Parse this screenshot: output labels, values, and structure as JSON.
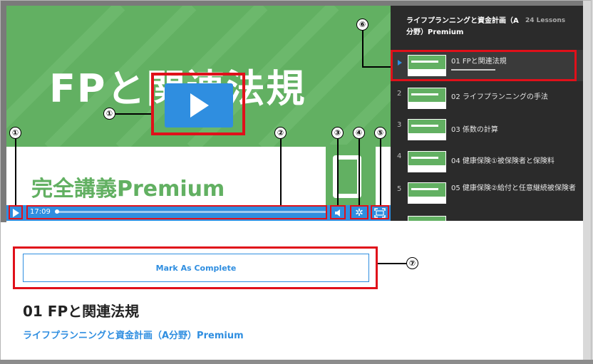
{
  "video": {
    "slide_title": "FPと関連法規",
    "slide_subtitle": "完全講義Premium",
    "time": "17:09",
    "progress_fraction": 0.0,
    "accent_color": "#2f8ee0",
    "slide_color": "#62b062"
  },
  "sidebar": {
    "course_title": "ライフプランニングと資金計画（A分野）Premium",
    "lesson_count": "24 Lessons",
    "lessons": [
      {
        "num": "",
        "label": "01 FPと関連法規",
        "active": true
      },
      {
        "num": "2",
        "label": "02 ライフプランニングの手法"
      },
      {
        "num": "3",
        "label": "03 係数の計算"
      },
      {
        "num": "4",
        "label": "04 健康保険①被保険者と保険料"
      },
      {
        "num": "5",
        "label": "05 健康保険②給付と任意継続被保険者"
      }
    ]
  },
  "content": {
    "complete_button": "Mark As Complete",
    "lesson_title": "01 FPと関連法規",
    "course_link": "ライフプランニングと資金計画（A分野）Premium"
  },
  "annotations": {
    "c1": "①",
    "c2": "②",
    "c3": "③",
    "c4": "④",
    "c5": "⑤",
    "c6": "⑥",
    "c7": "⑦",
    "highlight_color": "#e0101a"
  }
}
